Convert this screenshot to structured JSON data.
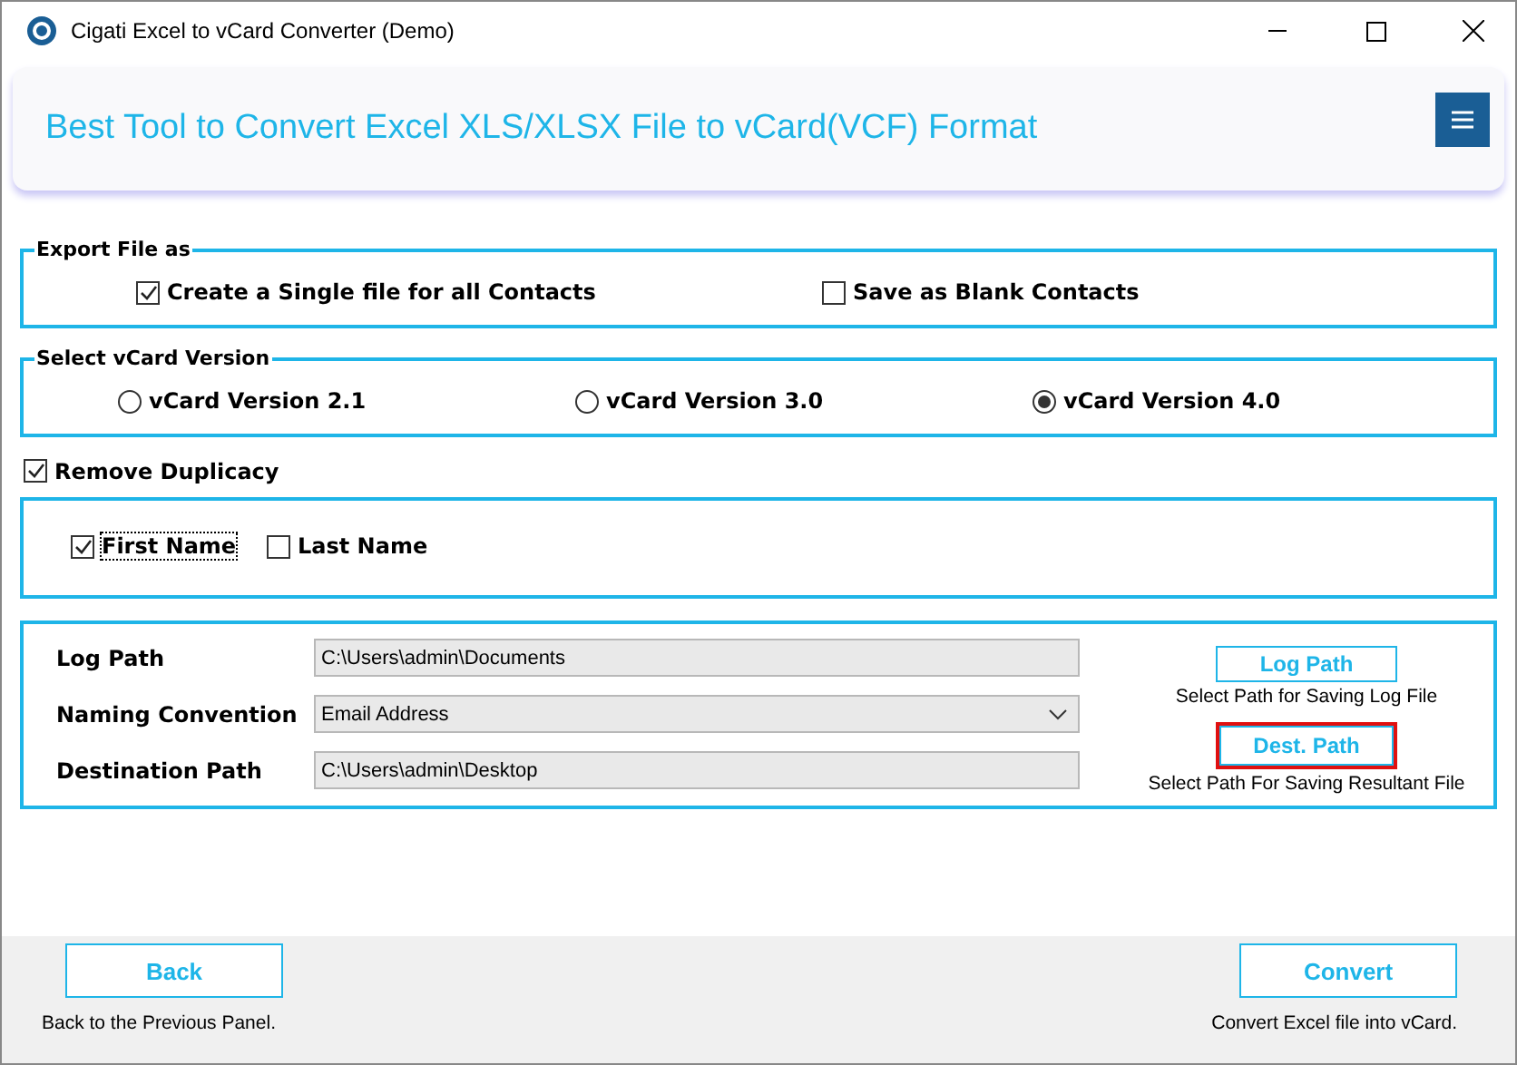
{
  "window": {
    "title": "Cigati Excel to vCard Converter (Demo)"
  },
  "header": {
    "title": "Best Tool to Convert Excel XLS/XLSX File to vCard(VCF) Format"
  },
  "export": {
    "legend": "Export File as",
    "options": [
      {
        "label": "Create a Single file for all Contacts",
        "checked": true
      },
      {
        "label": "Save as Blank Contacts",
        "checked": false
      }
    ]
  },
  "version": {
    "legend": "Select vCard Version",
    "options": [
      {
        "label": "vCard Version 2.1",
        "selected": false
      },
      {
        "label": "vCard Version 3.0",
        "selected": false
      },
      {
        "label": "vCard Version 4.0",
        "selected": true
      }
    ]
  },
  "duplicacy": {
    "label": "Remove Duplicacy",
    "checked": true,
    "fields": [
      {
        "label": "First Name",
        "checked": true,
        "focused": true
      },
      {
        "label": "Last Name",
        "checked": false,
        "focused": false
      }
    ]
  },
  "paths": {
    "rows": [
      {
        "kind": "text",
        "label": "Log Path",
        "value": "C:\\Users\\admin\\Documents"
      },
      {
        "kind": "select",
        "label": "Naming Convention",
        "value": "Email Address"
      },
      {
        "kind": "text",
        "label": "Destination Path",
        "value": "C:\\Users\\admin\\Desktop"
      }
    ],
    "buttons": [
      {
        "label": "Log Path",
        "hint": "Select Path for Saving Log File",
        "highlighted": false
      },
      {
        "label": "Dest. Path",
        "hint": "Select Path For Saving Resultant File",
        "highlighted": true
      }
    ]
  },
  "footer": {
    "back": {
      "label": "Back",
      "hint": "Back to the Previous Panel."
    },
    "convert": {
      "label": "Convert",
      "hint": "Convert Excel file into vCard."
    }
  }
}
